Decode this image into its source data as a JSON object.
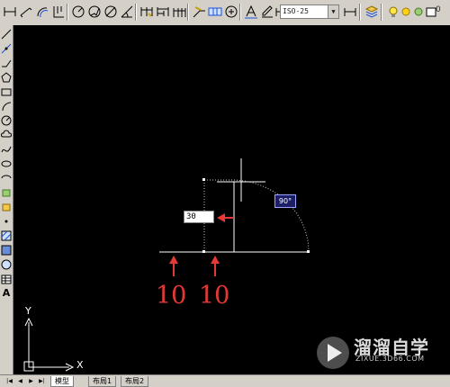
{
  "toolbar": {
    "dimstyle_value": "ISO-25",
    "layer_value": "0",
    "icons": [
      "dim-linear-icon",
      "dim-aligned-icon",
      "dim-arc-icon",
      "dim-ordinate-icon",
      "dim-radius-icon",
      "dim-jogged-icon",
      "dim-diameter-icon",
      "dim-angular-icon",
      "quick-dim-icon",
      "dim-baseline-icon",
      "dim-continue-icon",
      "quick-leader-icon",
      "tolerance-icon",
      "center-mark-icon",
      "dim-edit-icon",
      "dim-text-edit-icon",
      "dim-update-icon",
      "layer-properties-icon",
      "layer-state-icons"
    ]
  },
  "left_tools": [
    "line-icon",
    "construction-line-icon",
    "polyline-icon",
    "polygon-icon",
    "rectangle-icon",
    "arc-icon",
    "circle-icon",
    "revision-cloud-icon",
    "spline-icon",
    "ellipse-icon",
    "ellipse-arc-icon",
    "insert-block-icon",
    "make-block-icon",
    "point-icon",
    "hatch-icon",
    "gradient-icon",
    "region-icon",
    "table-icon",
    "multiline-text-icon"
  ],
  "canvas": {
    "dimension_input_value": "30",
    "angle_tooltip": "90°",
    "annotation_left": "10",
    "annotation_right": "10",
    "ucs_y_label": "Y",
    "ucs_x_label": "X",
    "colors": {
      "annotation": "#e43a37",
      "background": "#000000",
      "tooltip_bg": "#1c1f66"
    }
  },
  "watermark": {
    "title": "溜溜自学",
    "url": "ZIXUE.3D66.COM"
  },
  "tabs": [
    "模型",
    "布局1",
    "布局2"
  ]
}
